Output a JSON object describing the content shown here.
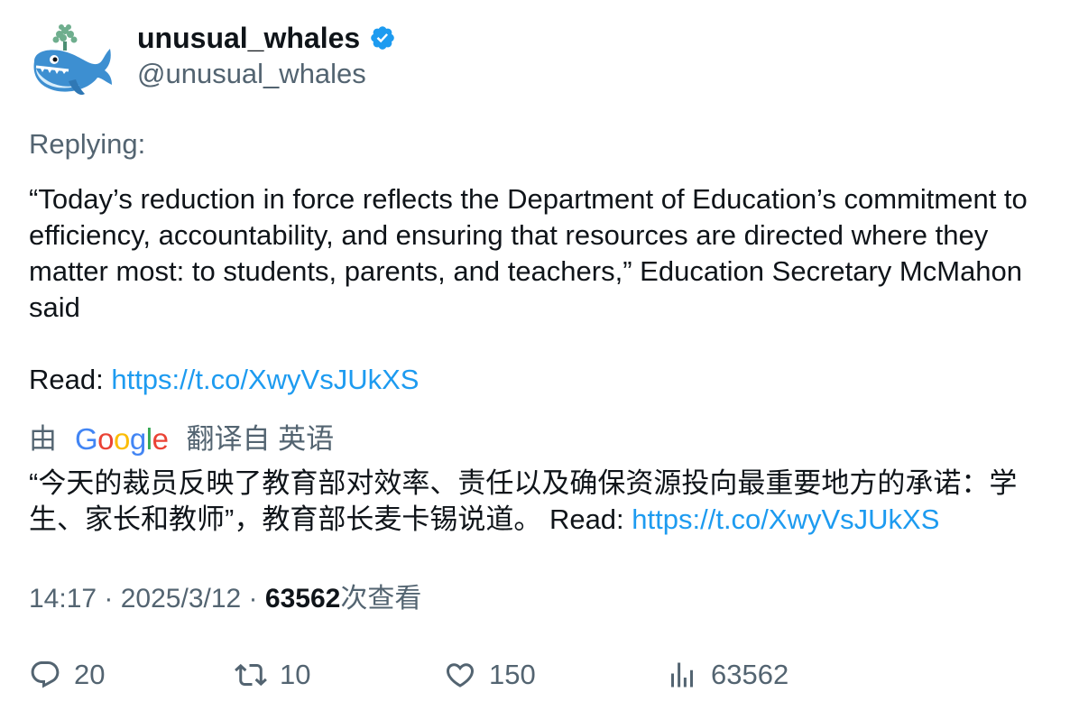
{
  "author": {
    "display_name": "unusual_whales",
    "handle": "@unusual_whales",
    "verified": true,
    "avatar_icon": "whale-icon"
  },
  "tweet": {
    "replying_label": "Replying:",
    "text": "“Today’s reduction in force reflects the Department of Education’s commitment to efficiency, accountability, and ensuring that resources are directed where they matter most: to students, parents, and teachers,” Education Secretary McMahon said",
    "read_label": "Read: ",
    "link": "https://t.co/XwyVsJUkXS"
  },
  "translation": {
    "prefix": "由",
    "provider": "Google",
    "suffix": "翻译自 英语",
    "text": "“今天的裁员反映了教育部对效率、责任以及确保资源投向最重要地方的承诺：学生、家长和教师”，教育部长麦卡锡说道。 ",
    "read_label": "Read: ",
    "link": "https://t.co/XwyVsJUkXS"
  },
  "meta": {
    "time": "14:17",
    "separator": " · ",
    "date": "2025/3/12",
    "views_count": "63562",
    "views_label": "次查看"
  },
  "actions": {
    "replies": "20",
    "retweets": "10",
    "likes": "150",
    "views": "63562"
  },
  "colors": {
    "link": "#1d9bf0",
    "secondary_text": "#536471",
    "primary_text": "#0f1419",
    "verified_badge": "#1d9bf0"
  }
}
